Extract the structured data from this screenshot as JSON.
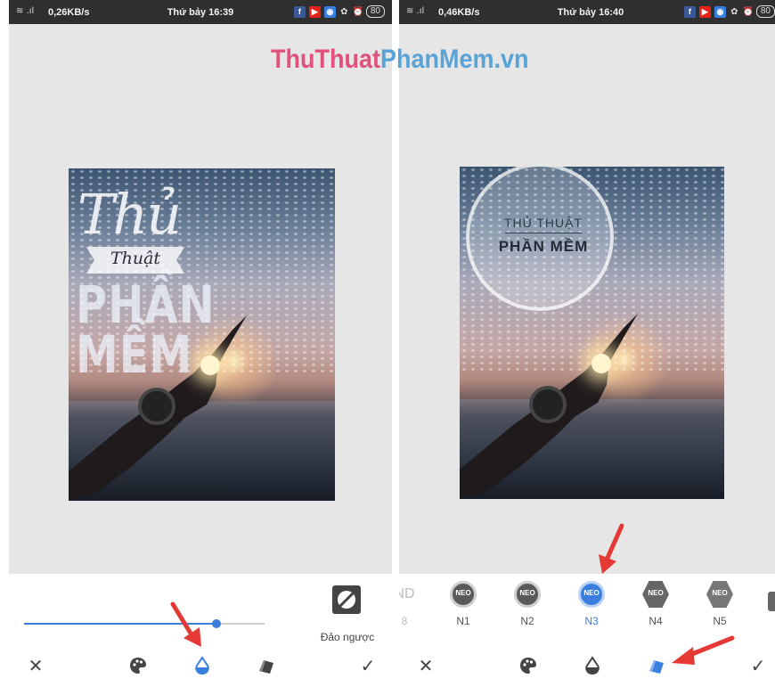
{
  "watermark": {
    "part1": "ThuThuat",
    "part2": "PhanMem.vn"
  },
  "left": {
    "status": {
      "speed": "0,26KB/s",
      "time": "Thứ bảy 16:39",
      "battery": "80"
    },
    "overlay": {
      "line1": "Thủ",
      "line2": "Thuật",
      "line3": "PHẦN",
      "line4": "MỀM"
    },
    "slider": {
      "value": 0.8
    },
    "invert_label": "Đảo ngược",
    "toolbar": [
      "close-icon",
      "palette-icon",
      "opacity-drop-icon",
      "texture-icon",
      "check-icon"
    ],
    "active_tool": 2
  },
  "right": {
    "status": {
      "speed": "0,46KB/s",
      "time": "Thứ bảy 16:40",
      "battery": "80"
    },
    "overlay": {
      "line1": "THỦ THUẬT",
      "line2": "PHẦN MỀM"
    },
    "badges": [
      {
        "label": "8",
        "text": "ND",
        "partial": true
      },
      {
        "label": "N1",
        "text": "NEO"
      },
      {
        "label": "N2",
        "text": "NEO"
      },
      {
        "label": "N3",
        "text": "NEO",
        "selected": true
      },
      {
        "label": "N4",
        "text": "NEO"
      },
      {
        "label": "N5",
        "text": "NEO"
      }
    ],
    "toolbar": [
      "close-icon",
      "palette-icon",
      "opacity-drop-icon",
      "texture-icon",
      "check-icon"
    ],
    "active_tool": 3,
    "colors": {
      "accent": "#3a7fe0",
      "arrow": "#e53935"
    }
  }
}
